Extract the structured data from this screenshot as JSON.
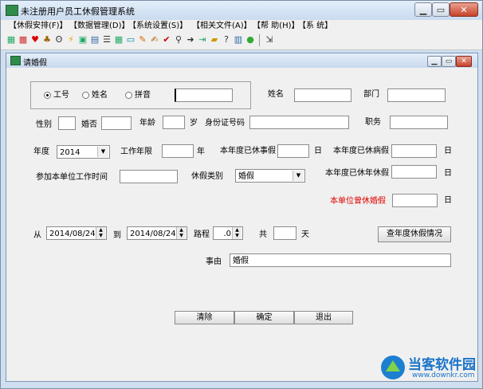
{
  "window": {
    "title": "未注册用户员工休假管理系统"
  },
  "menu": [
    "【休假安排(F)】",
    "【数据管理(D)】",
    "【系统设置(S)】",
    "【相关文件(A)】",
    "【帮 助(H)】",
    "【系 统】"
  ],
  "child": {
    "title": "请婚假"
  },
  "search": {
    "options": [
      "工号",
      "姓名",
      "拼音"
    ],
    "value": ""
  },
  "labels": {
    "name": "姓名",
    "dept": "部门",
    "gender": "性别",
    "married": "婚否",
    "age": "年龄",
    "age_unit": "岁",
    "id_card": "身份证号码",
    "position": "职务",
    "year": "年度",
    "work_years": "工作年限",
    "year_unit": "年",
    "used_personal": "本年度已休事假",
    "day_unit": "日",
    "used_sick": "本年度已休病假",
    "join_date": "参加本单位工作时间",
    "leave_type": "休假类别",
    "used_annual": "本年度已休年休假",
    "used_marriage": "本单位曾休婚假",
    "from": "从",
    "to": "到",
    "travel": "路程",
    "total": "共",
    "total_unit": "天",
    "reason": "事由"
  },
  "fields": {
    "year": "2014",
    "leave_type": "婚假",
    "start_date": "2014/08/24",
    "end_date": "2014/08/24",
    "travel": ".0",
    "reason": "婚假"
  },
  "buttons": {
    "annual_leave": "查年度休假情况",
    "clear": "清除",
    "ok": "确定",
    "exit": "退出"
  },
  "watermark": {
    "brand": "当客软件园",
    "url": "www.downkr.com"
  }
}
